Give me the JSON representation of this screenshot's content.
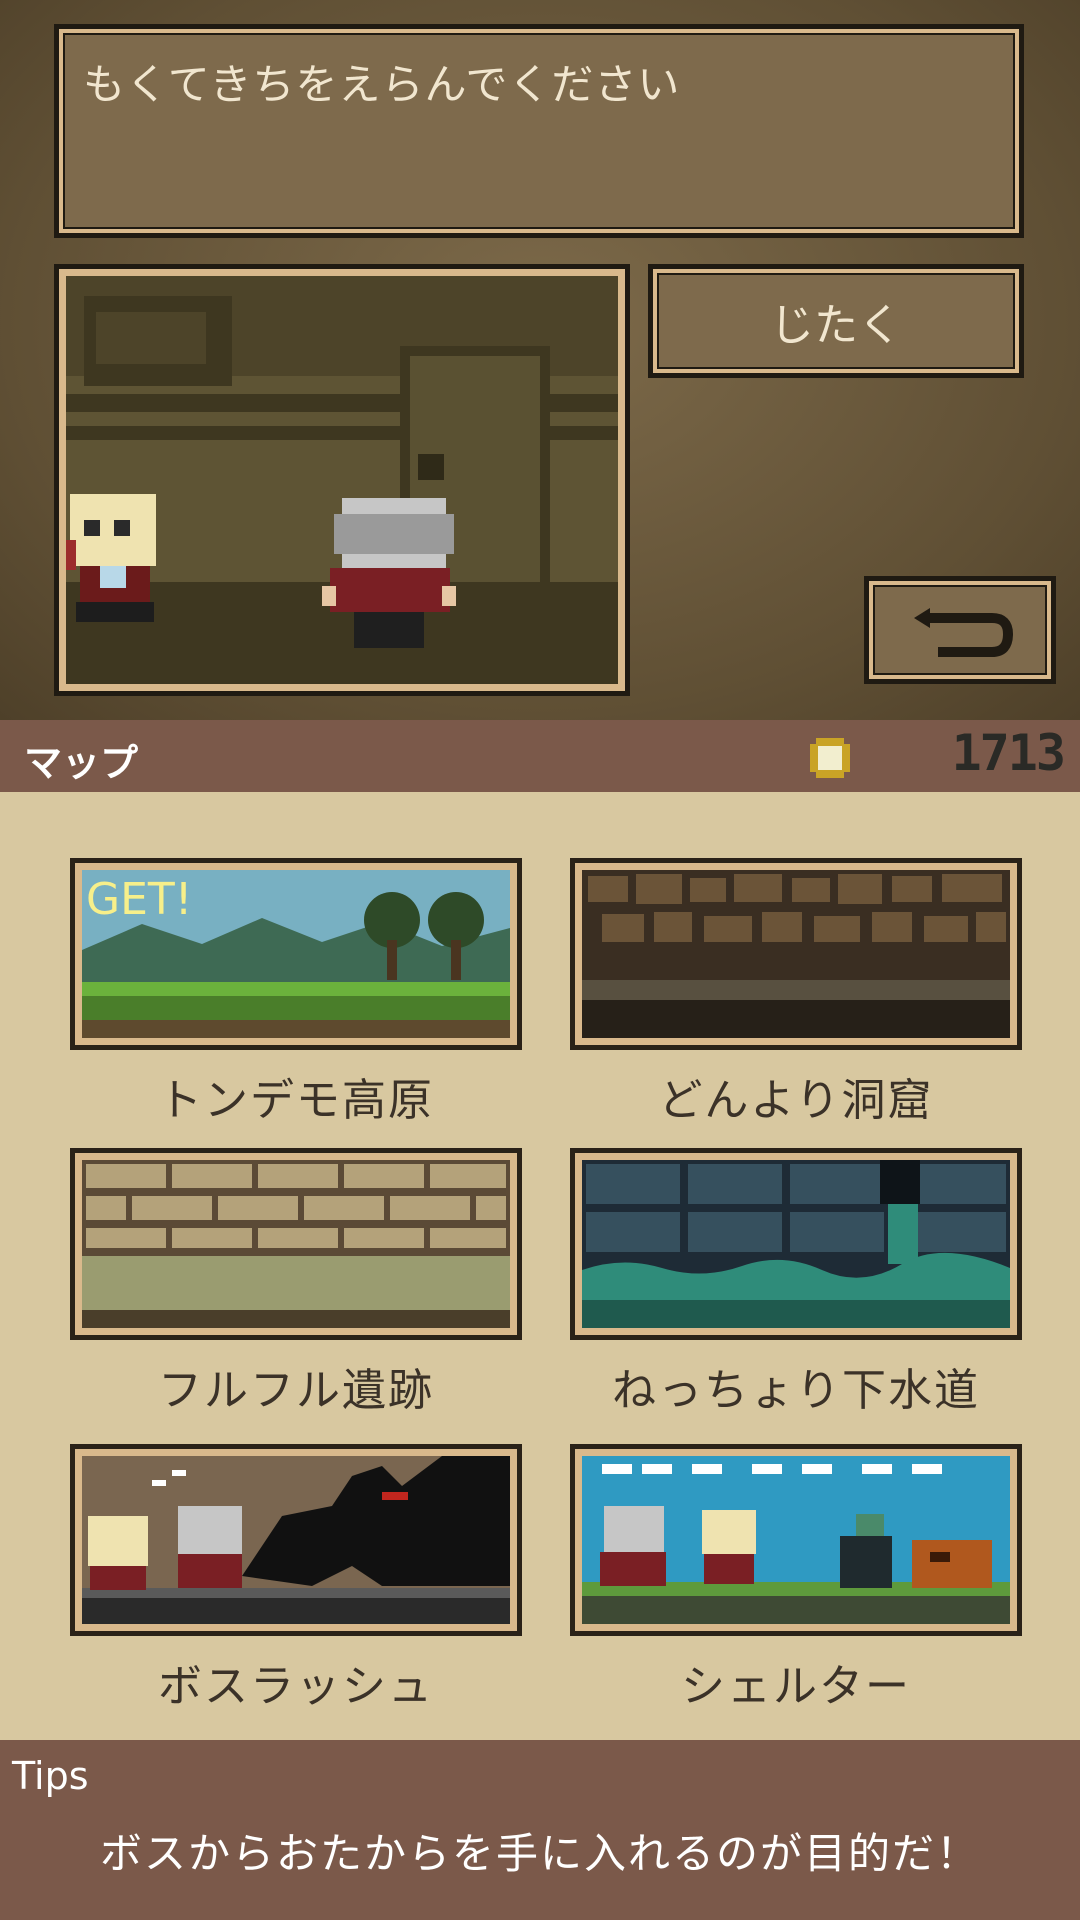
{
  "message": {
    "text": "もくてきちをえらんでください"
  },
  "buttons": {
    "home_label": "じたく"
  },
  "header": {
    "title": "マップ",
    "coins": "1713"
  },
  "maps": [
    {
      "name": "トンデモ高原",
      "badge": "GET!"
    },
    {
      "name": "どんより洞窟"
    },
    {
      "name": "フルフル遺跡"
    },
    {
      "name": "ねっちょり下水道"
    },
    {
      "name": "ボスラッシュ"
    },
    {
      "name": "シェルター"
    }
  ],
  "tips": {
    "heading": "Tips",
    "text": "ボスからおたからを手に入れるのが目的だ！"
  },
  "icons": {
    "back": "return-arrow-icon",
    "coin": "coin-icon"
  },
  "colors": {
    "bar": "#7b594a",
    "panel": "#d8c8a0",
    "frame": "#7e6a4c"
  }
}
